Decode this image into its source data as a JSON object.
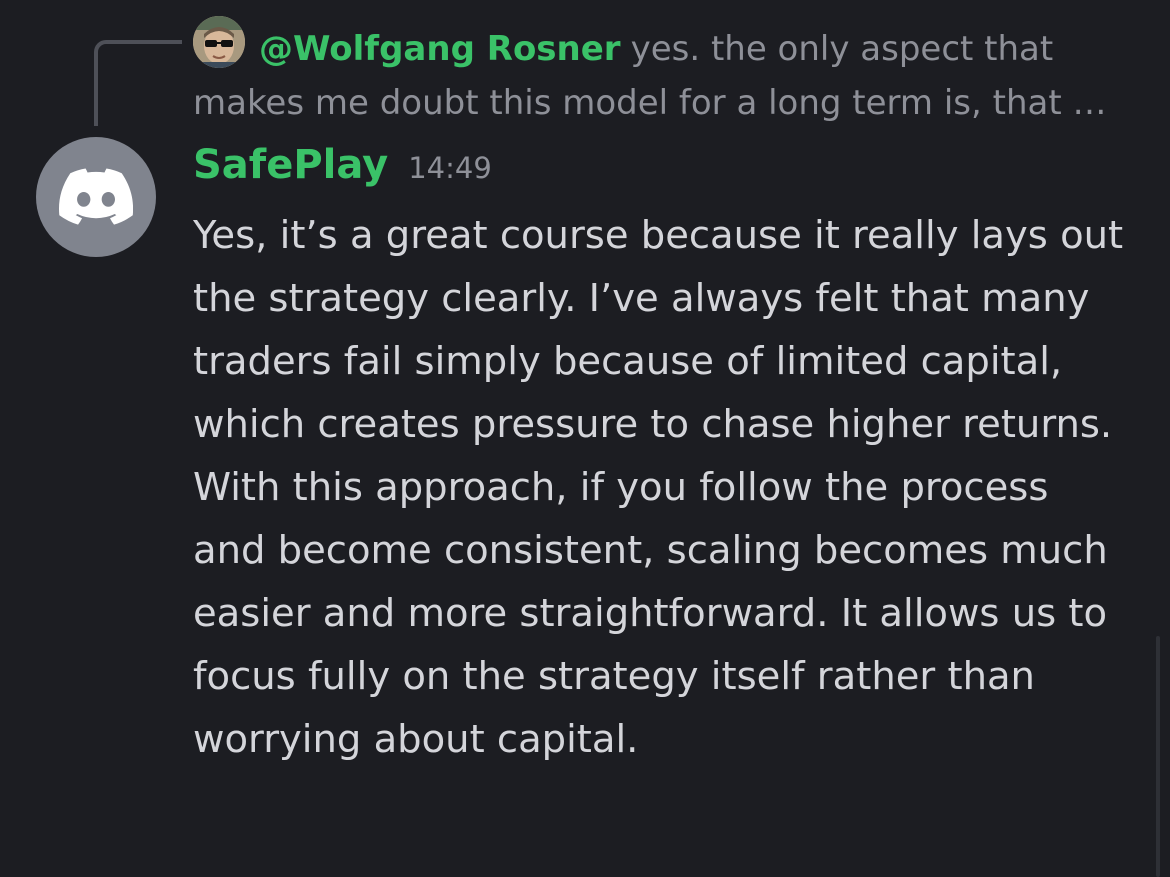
{
  "reply": {
    "author": "@Wolfgang Rosner",
    "preview": "yes. the only aspect that makes me doubt this model for a long term is, that …",
    "avatar_icon": "user-photo-avatar"
  },
  "message": {
    "author": "SafePlay",
    "timestamp": "14:49",
    "avatar_icon": "discord-logo-icon",
    "text": "Yes, it’s a great course because it really lays out the strategy clearly. I’ve always felt that many traders fail simply because of limited capital, which creates pressure to chase higher returns. With this approach, if you follow the process and become consistent, scaling becomes much easier and more straightforward. It allows us to focus fully on the strategy itself rather than worrying about capital."
  },
  "colors": {
    "background": "#1c1d22",
    "author": "#3ac268",
    "body_text": "#d4d5da",
    "muted_text": "#8e9098",
    "avatar_bg": "#80848e"
  }
}
